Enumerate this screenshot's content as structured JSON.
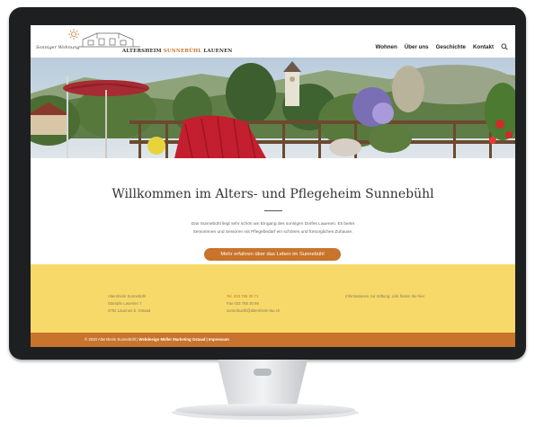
{
  "site": {
    "logo_script": "Sonniger Wohnung",
    "logo_name_a": "ALTERSHEIM ",
    "logo_name_b": "SUNNEBÜHL",
    "logo_name_c": " LAUENEN"
  },
  "nav": {
    "items": [
      {
        "label": "Wohnen"
      },
      {
        "label": "Über uns"
      },
      {
        "label": "Geschichte"
      },
      {
        "label": "Kontakt"
      }
    ],
    "search_icon": "search-icon"
  },
  "hero": {
    "slides": 4,
    "active_slide": 1
  },
  "welcome": {
    "title": "Willkommen im Alters- und Pflegeheim Sunnebühl",
    "intro_line1": "Das Sunnebühl liegt sehr schön am Eingang des sonnigen Dorfes Lauenen. Es bietet",
    "intro_line2": "Seniorinnen und Senioren mit Pflegebedarf ein schönes und fürsorgliches Zuhause.",
    "cta_label": "Mehr erfahren über das Leben im Sunnebühl"
  },
  "footer": {
    "address": [
      "Altersheim Sunnebühl",
      "Stampfe Lauenen 7",
      "3782 Lauenen b. Gstaad"
    ],
    "tel": "Tel. 033 765 30 71",
    "fax": "Fax 033 765 30 96",
    "email": "sunnebuehl@altersheim-lau.ch",
    "info": "Informationen zur Stiftung: Link finden Sie hier"
  },
  "bottom": {
    "copyright": "© 2020 Altersheim Sunnebühl | ",
    "webdesign": "Webdesign Müller Marketing Gstaad | Impressum"
  },
  "colors": {
    "accent": "#c8742c",
    "footer_bg": "#f7d96a",
    "monitor": "#1e1f21"
  }
}
